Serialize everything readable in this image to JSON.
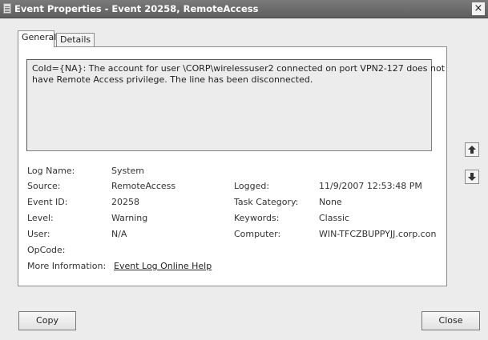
{
  "window": {
    "title": "Event Properties - Event 20258, RemoteAccess",
    "close_glyph": "×"
  },
  "tabs": [
    {
      "label": "General",
      "active": true
    },
    {
      "label": "Details",
      "active": false
    }
  ],
  "message": {
    "lines": [
      "CoId={NA}: The account for user \\CORP\\wirelessuser2 connected on port VPN2-127 does not",
      "have Remote Access privilege.  The line has been disconnected."
    ]
  },
  "fields": {
    "log_name": {
      "label": "Log Name:",
      "value": "System"
    },
    "source": {
      "label": "Source:",
      "value": "RemoteAccess"
    },
    "logged": {
      "label": "Logged:",
      "value": "11/9/2007 12:53:48 PM"
    },
    "event_id": {
      "label": "Event ID:",
      "value": "20258"
    },
    "task_category": {
      "label": "Task Category:",
      "value": "None"
    },
    "level": {
      "label": "Level:",
      "value": "Warning"
    },
    "keywords": {
      "label": "Keywords:",
      "value": "Classic"
    },
    "user": {
      "label": "User:",
      "value": "N/A"
    },
    "computer": {
      "label": "Computer:",
      "value": "WIN-TFCZBUPPYJJ.corp.con"
    },
    "opcode": {
      "label": "OpCode:",
      "value": ""
    },
    "more_info": {
      "label": "More Information:",
      "link": "Event Log Online Help"
    }
  },
  "nav": {
    "up_icon": "arrow-up-icon",
    "down_icon": "arrow-down-icon"
  },
  "buttons": {
    "copy": "Copy",
    "close": "Close"
  }
}
